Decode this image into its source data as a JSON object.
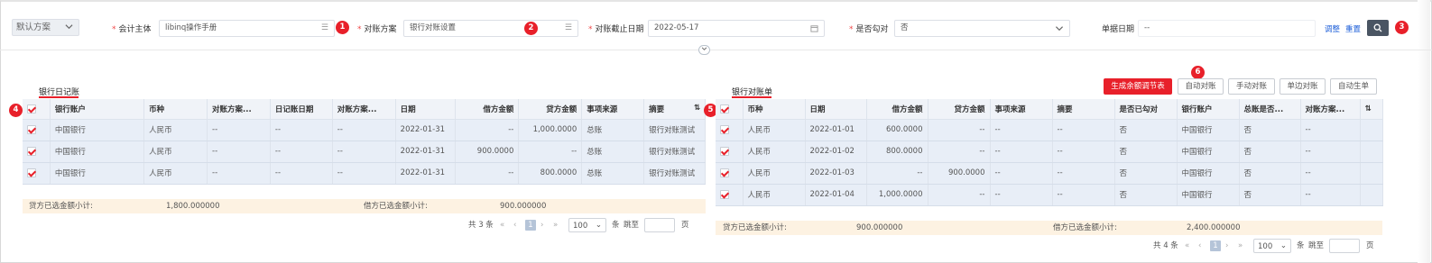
{
  "filter": {
    "scheme_select": "默认方案",
    "entity_label": "会计主体",
    "entity_value": "libinq操作手册",
    "recon_label": "对账方案",
    "recon_value": "银行对账设置",
    "cutoff_label": "对账截止日期",
    "cutoff_value": "2022-05-17",
    "hook_label": "是否勾对",
    "hook_value": "否",
    "doc_date_label": "单据日期",
    "doc_date_value": "--",
    "adjust_link": "调整",
    "reset_link": "重置",
    "badges": [
      "1",
      "2",
      "3"
    ]
  },
  "left": {
    "title": "银行日记账",
    "badge": "4",
    "columns": [
      "银行账户",
      "币种",
      "对账方案...",
      "日记账日期",
      "对账方案...",
      "日期",
      "借方金额",
      "贷方金额",
      "事项来源",
      "摘要"
    ],
    "rows": [
      [
        "中国银行",
        "人民币",
        "--",
        "--",
        "--",
        "2022-01-31",
        "--",
        "1,000.0000",
        "总账",
        "银行对账测试"
      ],
      [
        "中国银行",
        "人民币",
        "--",
        "--",
        "--",
        "2022-01-31",
        "900.0000",
        "--",
        "总账",
        "银行对账测试"
      ],
      [
        "中国银行",
        "人民币",
        "--",
        "--",
        "--",
        "2022-01-31",
        "--",
        "800.0000",
        "总账",
        "银行对账测试"
      ]
    ],
    "subtotal_credit_label": "贷方已选金额小计:",
    "subtotal_credit_value": "1,800.000000",
    "subtotal_debit_label": "借方已选金额小计:",
    "subtotal_debit_value": "900.000000",
    "pager": {
      "total": "共 3 条",
      "page": "1",
      "size": "100",
      "unit": "条",
      "jump": "跳至",
      "page_unit": "页"
    }
  },
  "right": {
    "title": "银行对账单",
    "badge_select": "5",
    "badge_auto": "6",
    "buttons": [
      "生成余额调节表",
      "自动对账",
      "手动对账",
      "单边对账",
      "自动生单"
    ],
    "columns": [
      "币种",
      "日期",
      "借方金额",
      "贷方金额",
      "事项来源",
      "摘要",
      "是否已勾对",
      "银行账户",
      "总账是否...",
      "对账方案..."
    ],
    "rows": [
      [
        "人民币",
        "2022-01-01",
        "600.0000",
        "--",
        "--",
        "--",
        "否",
        "中国银行",
        "否",
        "--"
      ],
      [
        "人民币",
        "2022-01-02",
        "800.0000",
        "--",
        "--",
        "--",
        "否",
        "中国银行",
        "否",
        "--"
      ],
      [
        "人民币",
        "2022-01-03",
        "--",
        "900.0000",
        "--",
        "--",
        "否",
        "中国银行",
        "否",
        "--"
      ],
      [
        "人民币",
        "2022-01-04",
        "1,000.0000",
        "--",
        "--",
        "--",
        "否",
        "中国银行",
        "否",
        "--"
      ]
    ],
    "subtotal_credit_label": "贷方已选金额小计:",
    "subtotal_credit_value": "900.000000",
    "subtotal_debit_label": "借方已选金额小计:",
    "subtotal_debit_value": "2,400.000000",
    "pager": {
      "total": "共 4 条",
      "page": "1",
      "size": "100",
      "unit": "条",
      "jump": "跳至",
      "page_unit": "页"
    }
  },
  "icons": {
    "list": "☰",
    "calendar": "▦",
    "chevron": "⌄",
    "search": "⌕",
    "settings": "⚙"
  }
}
